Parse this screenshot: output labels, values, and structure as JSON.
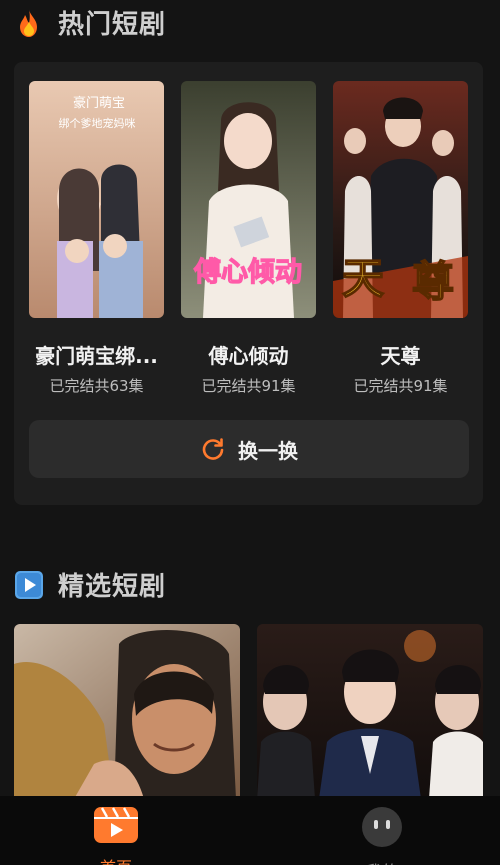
{
  "sections": {
    "hot": {
      "title": "热门短剧",
      "icon": "fire-icon"
    },
    "picks": {
      "title": "精选短剧",
      "icon": "play-square-icon"
    }
  },
  "dramas": [
    {
      "name": "豪门萌宝绑...",
      "status": "已完结共63集",
      "poster_text": [
        "豪门萌宝",
        "绑个爹地宠妈咪"
      ]
    },
    {
      "name": "傅心倾动",
      "status": "已完结共91集",
      "poster_text": [
        "傅心倾动"
      ]
    },
    {
      "name": "天尊",
      "status": "已完结共91集",
      "poster_text": [
        "天",
        "尊"
      ]
    }
  ],
  "swap_button": {
    "label": "换一换",
    "icon": "refresh-icon"
  },
  "picks": [
    {
      "icon": "poster-image"
    },
    {
      "icon": "poster-image"
    }
  ],
  "nav": {
    "home": {
      "label": "首页",
      "icon": "clapperboard-icon"
    },
    "mine": {
      "label": "我的",
      "icon": "face-icon"
    }
  },
  "colors": {
    "accent": "#ff7a2e",
    "background": "#141414",
    "card": "#1e1e1e",
    "button": "#2c2c2c"
  }
}
